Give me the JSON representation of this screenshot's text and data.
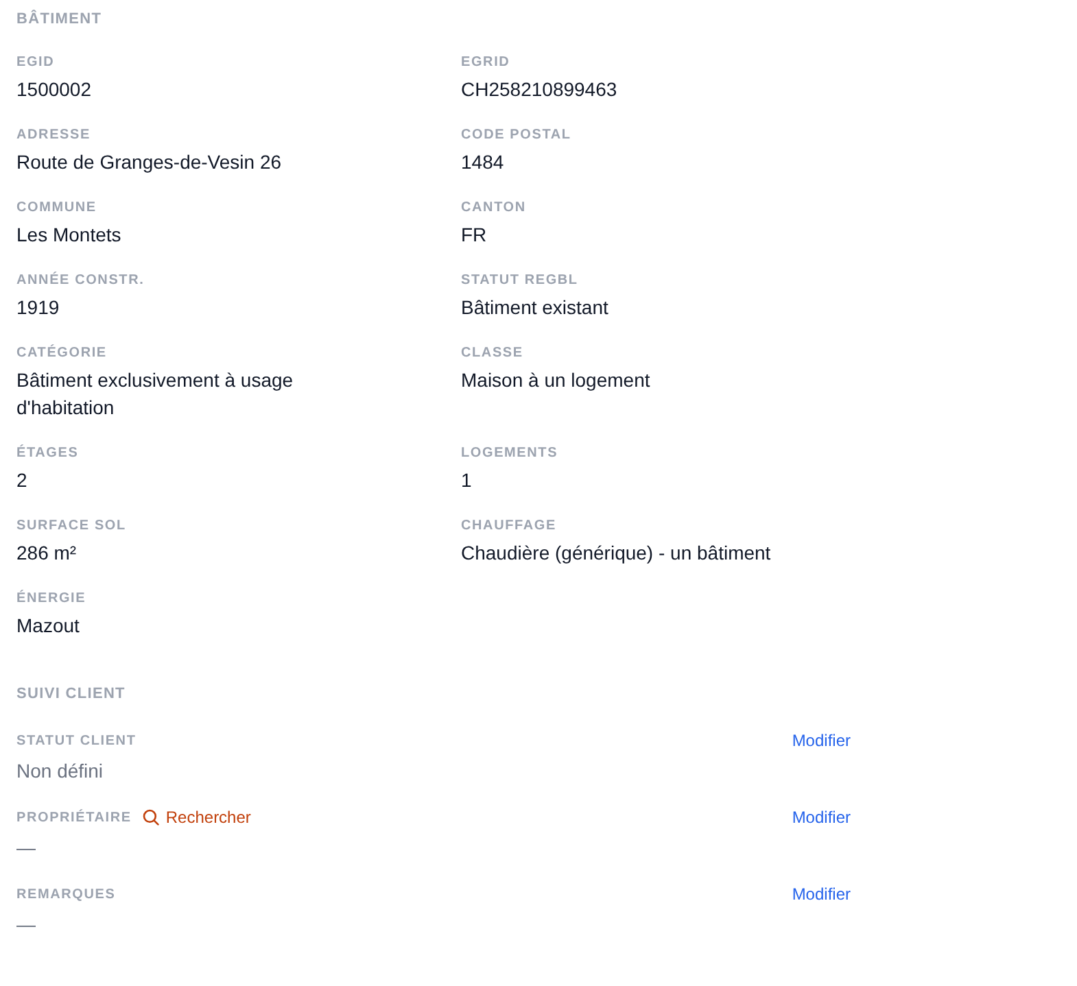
{
  "building": {
    "title": "BÂTIMENT",
    "fields": [
      {
        "label": "EGID",
        "value": "1500002"
      },
      {
        "label": "EGRID",
        "value": "CH258210899463"
      },
      {
        "label": "ADRESSE",
        "value": "Route de Granges-de-Vesin 26"
      },
      {
        "label": "CODE POSTAL",
        "value": "1484"
      },
      {
        "label": "COMMUNE",
        "value": "Les Montets"
      },
      {
        "label": "CANTON",
        "value": "FR"
      },
      {
        "label": "ANNÉE CONSTR.",
        "value": "1919"
      },
      {
        "label": "STATUT REGBL",
        "value": "Bâtiment existant"
      },
      {
        "label": "CATÉGORIE",
        "value": "Bâtiment exclusivement à usage d'habitation"
      },
      {
        "label": "CLASSE",
        "value": "Maison à un logement"
      },
      {
        "label": "ÉTAGES",
        "value": "2"
      },
      {
        "label": "LOGEMENTS",
        "value": "1"
      },
      {
        "label": "SURFACE SOL",
        "value": "286 m²"
      },
      {
        "label": "CHAUFFAGE",
        "value": "Chaudière (générique) - un bâtiment"
      },
      {
        "label": "ÉNERGIE",
        "value": "Mazout"
      }
    ]
  },
  "client_tracking": {
    "title": "SUIVI CLIENT",
    "rows": [
      {
        "label": "STATUT CLIENT",
        "value": "Non défini",
        "action": "Modifier"
      },
      {
        "label": "PROPRIÉTAIRE",
        "search_link": "Rechercher",
        "value": "—",
        "action": "Modifier"
      },
      {
        "label": "REMARQUES",
        "value": "—",
        "action": "Modifier"
      }
    ]
  }
}
